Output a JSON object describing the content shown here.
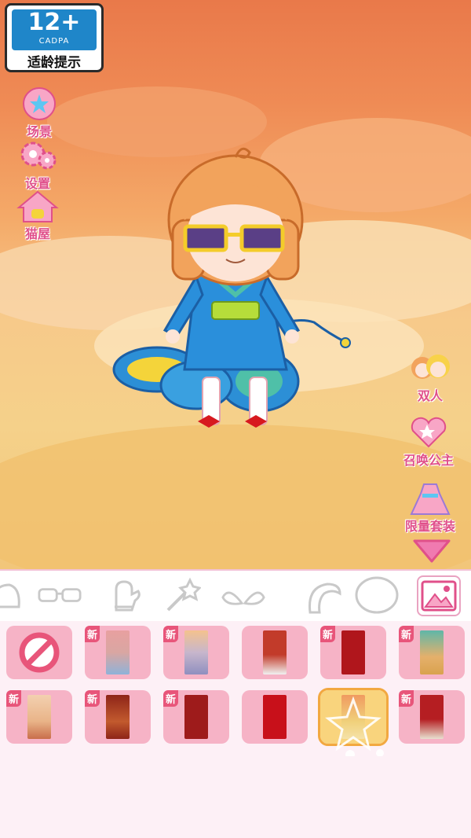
{
  "age_rating": {
    "number": "12+",
    "org": "CADPA",
    "tip": "适龄提示"
  },
  "left_menu": [
    {
      "name": "scene",
      "label": "场景",
      "icon": "star-flower-icon"
    },
    {
      "name": "settings",
      "label": "设置",
      "icon": "gear-icon"
    },
    {
      "name": "cat-house",
      "label": "猫屋",
      "icon": "house-icon"
    }
  ],
  "right_menu": [
    {
      "name": "duo",
      "label": "双人",
      "icon": "two-girls-icon"
    },
    {
      "name": "summon-princess",
      "label": "召唤公主",
      "icon": "heart-wand-icon"
    },
    {
      "name": "limited-outfit",
      "label": "限量套装",
      "icon": "dress-icon"
    }
  ],
  "toolbar": [
    {
      "name": "hat",
      "icon": "hat-icon"
    },
    {
      "name": "glasses",
      "icon": "glasses-icon"
    },
    {
      "name": "glove",
      "icon": "glove-icon"
    },
    {
      "name": "wand",
      "icon": "wand-icon"
    },
    {
      "name": "wings",
      "icon": "wings-icon"
    },
    {
      "name": "tail",
      "icon": "tail-icon"
    },
    {
      "name": "bubble",
      "icon": "bubble-icon"
    },
    {
      "name": "background",
      "icon": "image-icon",
      "active": true
    }
  ],
  "new_label": "新",
  "backgrounds": [
    {
      "type": "none"
    },
    {
      "new": true,
      "color": "#d9a6a2"
    },
    {
      "new": true,
      "color": "#c7b6cc"
    },
    {
      "new": false,
      "color": "#c23b2a"
    },
    {
      "new": true,
      "color": "#b0161c"
    },
    {
      "new": true,
      "color": "#e5b06b"
    },
    {
      "new": true,
      "color": "#e9b488"
    },
    {
      "new": true,
      "color": "#8e2418"
    },
    {
      "new": true,
      "color": "#9e1b1b"
    },
    {
      "new": false,
      "color": "#c8101a"
    },
    {
      "new": false,
      "color": "#f0d07a",
      "selected": true
    },
    {
      "new": true,
      "color": "#b51e22"
    }
  ],
  "colors": {
    "accent_pink": "#e0508a",
    "tile_pink": "#f6b3c6",
    "rating_blue": "#1f86c9"
  }
}
